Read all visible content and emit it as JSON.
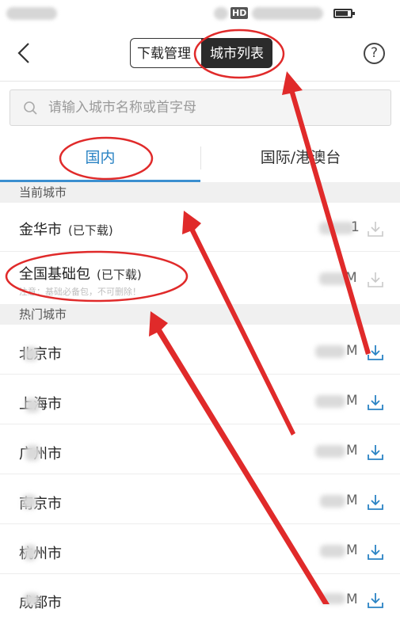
{
  "status_bar": {
    "hd": "HD"
  },
  "nav": {
    "segment_left": "下载管理",
    "segment_right": "城市列表",
    "help": "?"
  },
  "search": {
    "placeholder": "请输入城市名称或首字母"
  },
  "tabs": {
    "domestic": "国内",
    "international": "国际/港澳台"
  },
  "current_section": {
    "header": "当前城市",
    "items": [
      {
        "name": "金华市",
        "tag": "(已下载)",
        "size": "1"
      },
      {
        "name": "全国基础包",
        "tag": "(已下载)",
        "note": "注意：基础必备包，不可删除！",
        "size": "M"
      }
    ]
  },
  "hot_section": {
    "header": "热门城市",
    "items": [
      {
        "name": "北京市",
        "size": "M"
      },
      {
        "name": "上海市",
        "size": "M"
      },
      {
        "name": "广州市",
        "size": "M"
      },
      {
        "name": "南京市",
        "size": "M"
      },
      {
        "name": "杭州市",
        "size": "M"
      },
      {
        "name": "成都市",
        "size": "M"
      }
    ]
  },
  "colors": {
    "accent": "#2a83c4",
    "annotation": "#e02a2a",
    "download_active": "#2a83c4",
    "download_done": "#c9c9c9"
  }
}
